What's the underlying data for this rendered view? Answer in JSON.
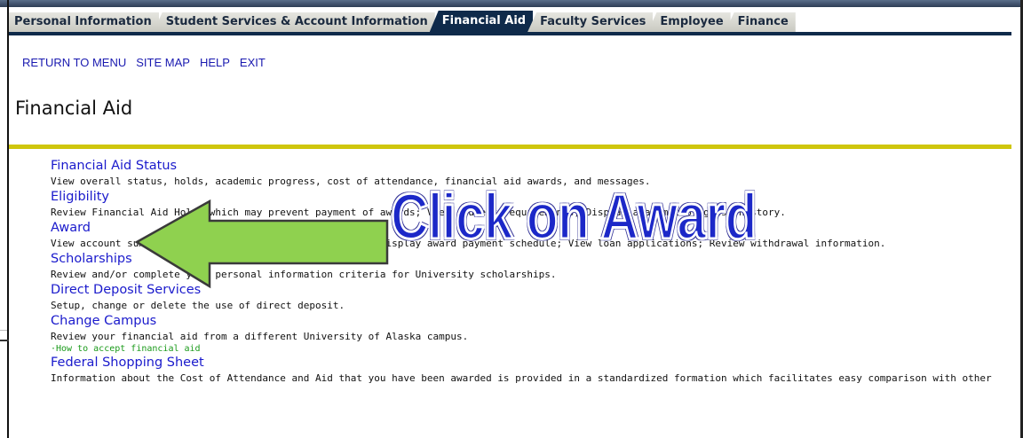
{
  "tabs": [
    {
      "label": "Personal Information",
      "active": false
    },
    {
      "label": "Student Services & Account Information",
      "active": false
    },
    {
      "label": "Financial Aid",
      "active": true
    },
    {
      "label": "Faculty Services",
      "active": false
    },
    {
      "label": "Employee",
      "active": false
    },
    {
      "label": "Finance",
      "active": false
    }
  ],
  "nav_links": {
    "return_to_menu": "RETURN TO MENU",
    "site_map": "SITE MAP",
    "help": "HELP",
    "exit": "EXIT"
  },
  "page_title": "Financial Aid",
  "menu_items": [
    {
      "title": "Financial Aid Status",
      "description": "View overall status, holds, academic progress, cost of attendance, financial aid awards, and messages."
    },
    {
      "title": "Eligibility",
      "description": "Review Financial Aid Holds which may prevent payment of awards; View student requirements; Display academic progress history."
    },
    {
      "title": "Award",
      "description": "View account summary; View awards; Accept award offers; Display award payment schedule; View loan applications; Review withdrawal information."
    },
    {
      "title": "Scholarships",
      "description": "Review and/or complete your personal information criteria for University scholarships."
    },
    {
      "title": "Direct Deposit Services",
      "description": "Setup, change or delete the use of direct deposit."
    },
    {
      "title": "Change Campus",
      "description": "Review your financial aid from a different University of Alaska campus.",
      "extra": "·How to accept financial aid"
    },
    {
      "title": "Federal Shopping Sheet",
      "description": "Information about the Cost of Attendance and Aid that you have been awarded is provided in a standardized formation which facilitates easy comparison with other"
    }
  ],
  "annotation": {
    "text": "Click on Award",
    "arrow_color": "#8fd14f",
    "text_color": "#1c28c8"
  },
  "colors": {
    "tab_active": "#0f2a4a",
    "link": "#1a1acc",
    "rule": "#cfc60c"
  }
}
